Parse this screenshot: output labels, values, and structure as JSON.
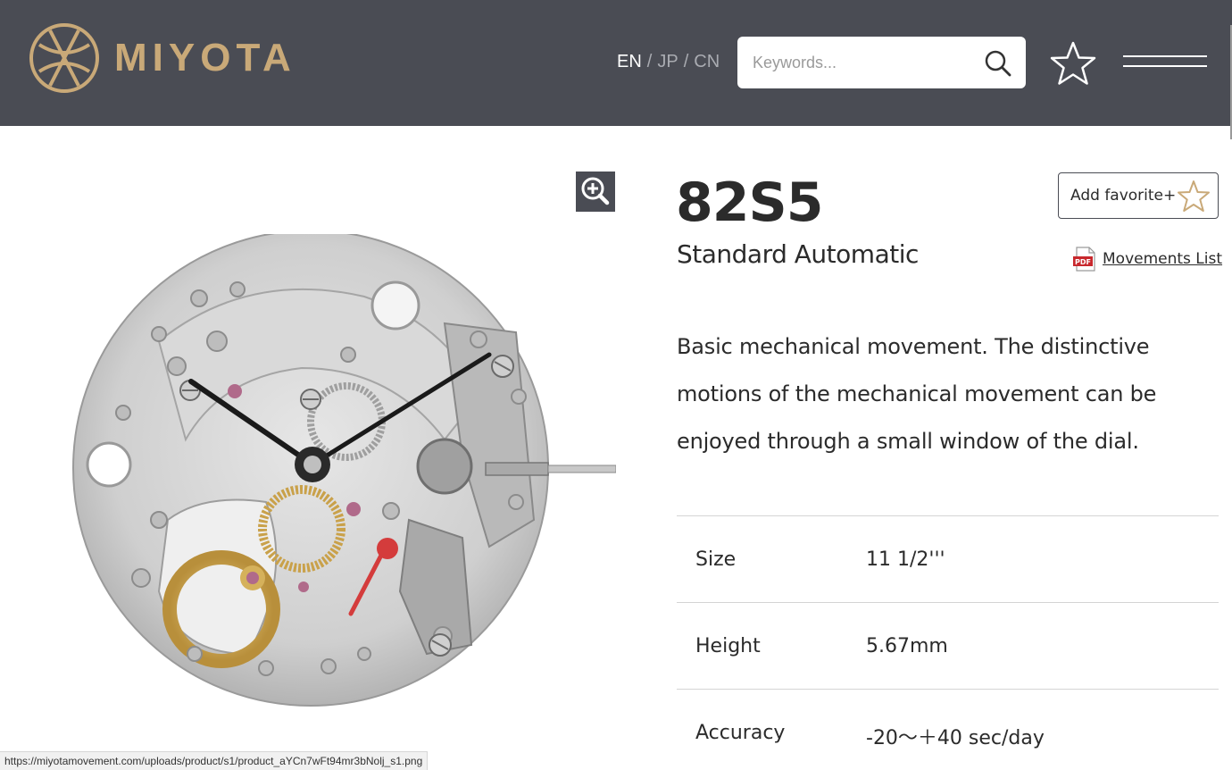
{
  "brand": {
    "name": "MIYOTA",
    "color": "#c9a978"
  },
  "header": {
    "background": "#4a4c54",
    "languages": [
      {
        "code": "EN",
        "active": true
      },
      {
        "code": "JP",
        "active": false
      },
      {
        "code": "CN",
        "active": false
      }
    ],
    "lang_separator": "/",
    "search": {
      "placeholder": "Keywords...",
      "value": ""
    },
    "icons": {
      "search": "search-icon",
      "favorites": "star-icon",
      "menu": "hamburger-menu-icon"
    }
  },
  "product": {
    "model": "82S5",
    "type": "Standard Automatic",
    "add_favorite_label": "Add favorite+",
    "movements_list_label": "Movements List",
    "pdf_icon_text": "PDF",
    "description": "Basic mechanical movement. The distinctive motions of the mechanical movement can be enjoyed through a small window of the dial.",
    "image_icon": "zoom-in-icon",
    "specs": [
      {
        "label": "Size",
        "value": "11 1/2'''"
      },
      {
        "label": "Height",
        "value": "5.67mm"
      },
      {
        "label": "Accuracy",
        "value": "-20〜＋40 sec/day"
      }
    ]
  },
  "status_bar": {
    "url": "https://miyotamovement.com/uploads/product/s1/product_aYCn7wFt94mr3bNolj_s1.png"
  }
}
